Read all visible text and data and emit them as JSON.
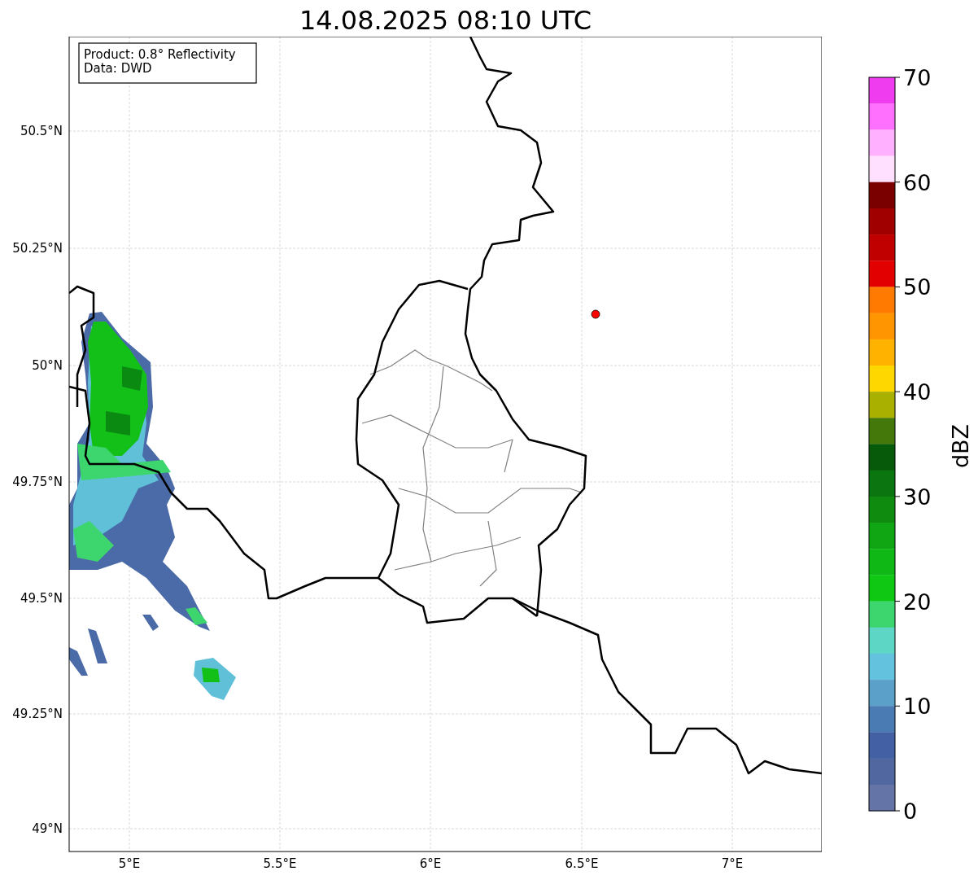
{
  "title": "14.08.2025 08:10 UTC",
  "info_box": {
    "lines": [
      "Product: 0.8° Reflectivity",
      "Data: DWD"
    ]
  },
  "map": {
    "lat_ticks": [
      "50.5°N",
      "50.25°N",
      "50°N",
      "49.75°N",
      "49.5°N",
      "49.25°N",
      "49°N"
    ],
    "lon_ticks": [
      "5°E",
      "5.5°E",
      "6°E",
      "6.5°E",
      "7°E"
    ]
  },
  "colorbar": {
    "label": "dBZ",
    "ticks": [
      "70",
      "60",
      "50",
      "40",
      "30",
      "20",
      "10",
      "0"
    ],
    "bands": [
      {
        "color": "#ee3cee"
      },
      {
        "color": "#ff70ff"
      },
      {
        "color": "#ffb0ff"
      },
      {
        "color": "#ffe0ff"
      },
      {
        "color": "#7a0000"
      },
      {
        "color": "#a00000"
      },
      {
        "color": "#c00000"
      },
      {
        "color": "#e30000"
      },
      {
        "color": "#ff7a00"
      },
      {
        "color": "#ff9500"
      },
      {
        "color": "#ffb300"
      },
      {
        "color": "#ffd700"
      },
      {
        "color": "#aab000"
      },
      {
        "color": "#45780a"
      },
      {
        "color": "#075a0a"
      },
      {
        "color": "#0b7510"
      },
      {
        "color": "#0f8c10"
      },
      {
        "color": "#10a512"
      },
      {
        "color": "#0fb814"
      },
      {
        "color": "#0fc814"
      },
      {
        "color": "#3dd66e"
      },
      {
        "color": "#5ed6c6"
      },
      {
        "color": "#63c3de"
      },
      {
        "color": "#5ba0c8"
      },
      {
        "color": "#4a7cb3"
      },
      {
        "color": "#4460a4"
      },
      {
        "color": "#5167a0"
      },
      {
        "color": "#6474a6"
      }
    ]
  }
}
